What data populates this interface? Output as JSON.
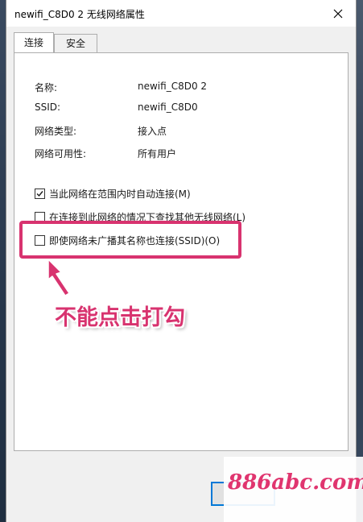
{
  "window": {
    "title": "newifi_C8D0 2 无线网络属性",
    "close_glyph": "✕"
  },
  "tabs": [
    {
      "label": "连接",
      "active": true
    },
    {
      "label": "安全",
      "active": false
    }
  ],
  "info": {
    "name_label": "名称:",
    "name_value": "newifi_C8D0 2",
    "ssid_label": "SSID:",
    "ssid_value": "newifi_C8D0",
    "type_label": "网络类型:",
    "type_value": "接入点",
    "availability_label": "网络可用性:",
    "availability_value": "所有用户"
  },
  "options": [
    {
      "label": "当此网络在范围内时自动连接(M)",
      "checked": true
    },
    {
      "label": "在连接到此网络的情况下查找其他无线网络(L)",
      "checked": false
    },
    {
      "label": "即使网络未广播其名称也连接(SSID)(O)",
      "checked": false
    }
  ],
  "annotation": {
    "text": "不能点击打勾",
    "color": "#d8336f"
  },
  "watermark": {
    "text": "886abc.com"
  },
  "colors": {
    "accent": "#0078d7",
    "highlight": "#d8336f"
  }
}
